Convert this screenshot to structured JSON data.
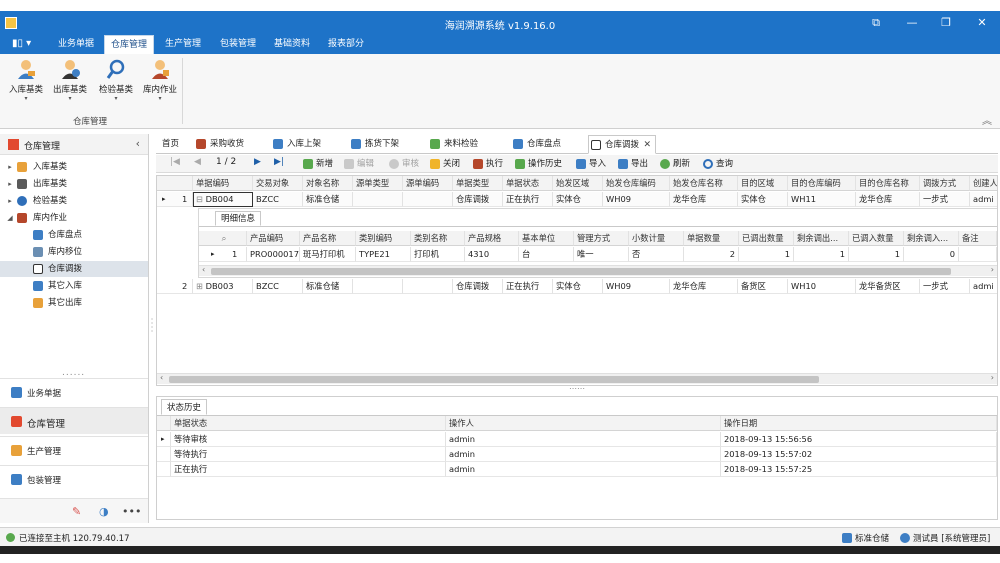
{
  "window": {
    "title": "海润溯源系统 v1.9.16.0",
    "controls": [
      "⧉",
      "—",
      "❐",
      "✕"
    ]
  },
  "menu": {
    "app_button": "▮▯ ▾",
    "tabs": [
      {
        "label": "业务单据"
      },
      {
        "label": "仓库管理"
      },
      {
        "label": "生产管理"
      },
      {
        "label": "包装管理"
      },
      {
        "label": "基础资料"
      },
      {
        "label": "报表部分"
      }
    ]
  },
  "ribbon": {
    "buttons": [
      {
        "label": "入库基类",
        "icon": "person-inbound-icon"
      },
      {
        "label": "出库基类",
        "icon": "person-outbound-icon"
      },
      {
        "label": "检验基类",
        "icon": "magnifier-icon"
      },
      {
        "label": "库内作业",
        "icon": "person-tools-icon"
      }
    ],
    "group_label": "仓库管理",
    "collapse": "︽"
  },
  "sidebar": {
    "header": "仓库管理",
    "collapse": "‹",
    "tree": [
      {
        "label": "入库基类",
        "arrow": "▸",
        "level": 0
      },
      {
        "label": "出库基类",
        "arrow": "▸",
        "level": 0
      },
      {
        "label": "检验基类",
        "arrow": "▸",
        "level": 0
      },
      {
        "label": "库内作业",
        "arrow": "◢",
        "level": 0
      },
      {
        "label": "仓库盘点",
        "arrow": "",
        "level": 1
      },
      {
        "label": "库内移位",
        "arrow": "",
        "level": 1
      },
      {
        "label": "仓库调拨",
        "arrow": "",
        "level": 1
      },
      {
        "label": "其它入库",
        "arrow": "",
        "level": 1
      },
      {
        "label": "其它出库",
        "arrow": "",
        "level": 1
      }
    ],
    "grip": "......",
    "nav": [
      {
        "label": "业务单据"
      },
      {
        "label": "仓库管理"
      },
      {
        "label": "生产管理"
      },
      {
        "label": "包装管理"
      }
    ],
    "tools": [
      "✎",
      "◑",
      "•••"
    ]
  },
  "doc_tabs": [
    {
      "label": "首页"
    },
    {
      "label": "采购收货"
    },
    {
      "label": "入库上架"
    },
    {
      "label": "拣货下架"
    },
    {
      "label": "来料检验"
    },
    {
      "label": "仓库盘点"
    },
    {
      "label": "仓库调拨",
      "close": "✕"
    }
  ],
  "toolbar": {
    "nav_first": "|◀",
    "nav_prev": "◀",
    "page": "1 / 2",
    "nav_next": "▶",
    "nav_last": "▶|",
    "buttons": [
      {
        "label": "新增",
        "enabled": true
      },
      {
        "label": "编辑",
        "enabled": false
      },
      {
        "label": "审核",
        "enabled": false
      },
      {
        "label": "关闭",
        "enabled": true
      },
      {
        "label": "执行",
        "enabled": true
      },
      {
        "label": "操作历史",
        "enabled": true
      },
      {
        "label": "导入",
        "enabled": true
      },
      {
        "label": "导出",
        "enabled": true
      },
      {
        "label": "刷新",
        "enabled": true
      },
      {
        "label": "查询",
        "enabled": true
      }
    ]
  },
  "main_table": {
    "columns": [
      "单据编码",
      "交易对象",
      "对象名称",
      "源单类型",
      "源单编码",
      "单据类型",
      "单据状态",
      "始发区域",
      "始发仓库编码",
      "始发仓库名称",
      "目的区域",
      "目的仓库编码",
      "目的仓库名称",
      "调拨方式",
      "创建人"
    ],
    "rows": [
      {
        "num": "1",
        "expander": "⊟",
        "cells": [
          "DB004",
          "BZCC",
          "标准仓储",
          "",
          "",
          "仓库调拨",
          "正在执行",
          "实体仓",
          "WH09",
          "龙华仓库",
          "实体仓",
          "WH11",
          "龙华仓库",
          "一步式",
          "admi"
        ]
      },
      {
        "num": "2",
        "expander": "⊞",
        "cells": [
          "DB003",
          "BZCC",
          "标准仓储",
          "",
          "",
          "仓库调拨",
          "正在执行",
          "实体仓",
          "WH09",
          "龙华仓库",
          "备货区",
          "WH10",
          "龙华备货区",
          "一步式",
          "admi"
        ]
      }
    ]
  },
  "detail": {
    "tab": "明细信息",
    "search_icon": "⌕",
    "columns": [
      "产品编码",
      "产品名称",
      "类别编码",
      "类别名称",
      "产品规格",
      "基本单位",
      "管理方式",
      "小数计量",
      "单据数量",
      "已调出数量",
      "剩余调出...",
      "已调入数量",
      "剩余调入...",
      "备注"
    ],
    "rows": [
      {
        "num": "1",
        "cells": [
          "PRO000017",
          "斑马打印机",
          "TYPE21",
          "打印机",
          "4310",
          "台",
          "唯一",
          "否",
          "2",
          "1",
          "1",
          "1",
          "0",
          ""
        ]
      }
    ]
  },
  "splitter": "⋯⋯",
  "history": {
    "tab": "状态历史",
    "columns": [
      "单据状态",
      "操作人",
      "操作日期"
    ],
    "rows": [
      {
        "cells": [
          "等待审核",
          "admin",
          "2018-09-13 15:56:56"
        ]
      },
      {
        "cells": [
          "等待执行",
          "admin",
          "2018-09-13 15:57:02"
        ]
      },
      {
        "cells": [
          "正在执行",
          "admin",
          "2018-09-13 15:57:25"
        ]
      }
    ]
  },
  "status": {
    "connection": "已连接至主机 120.79.40.17",
    "warehouse": "标准仓储",
    "user": "测试員 [系统管理员]"
  },
  "colors": {
    "title_blue": "#1e73c8",
    "accent_red": "#e2492f",
    "status_green": "#58a84d"
  }
}
